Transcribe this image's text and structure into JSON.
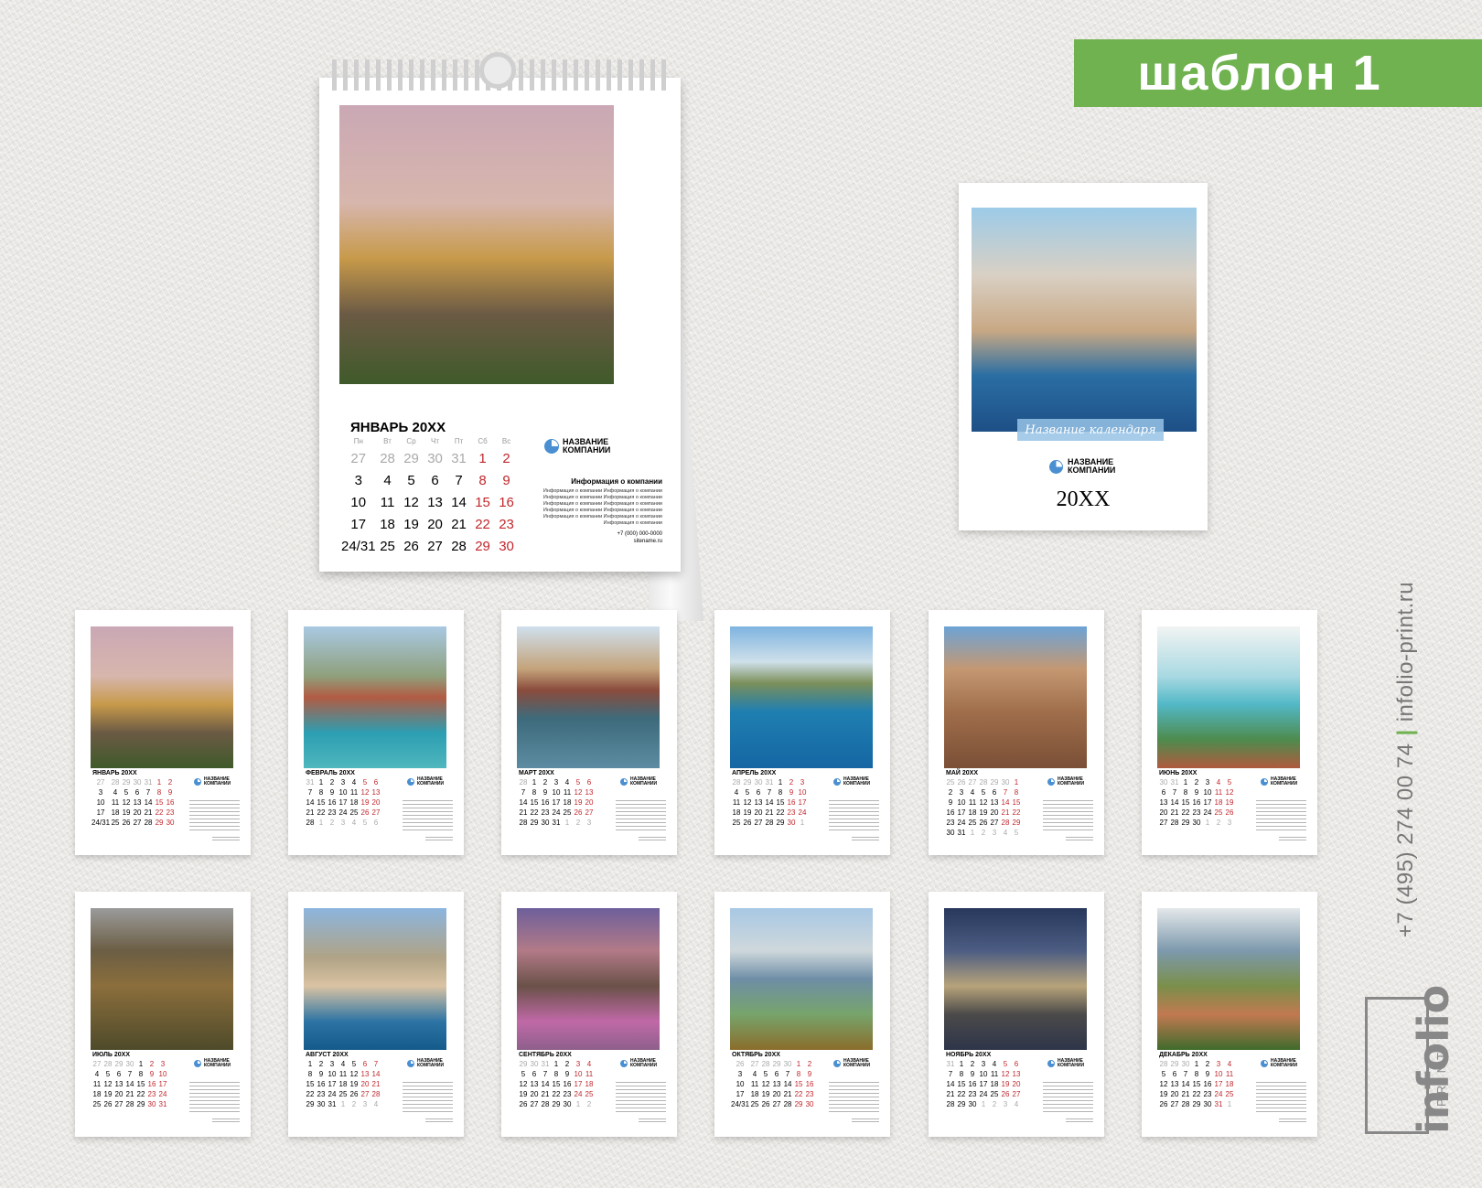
{
  "banner": {
    "label": "шаблон 1"
  },
  "desk": {
    "month_title": "ЯНВАРЬ 20ХХ",
    "weekdays": [
      "Пн",
      "Вт",
      "Ср",
      "Чт",
      "Пт",
      "Сб",
      "Вс"
    ],
    "weeks": [
      [
        "27",
        "28",
        "29",
        "30",
        "31",
        "1",
        "2"
      ],
      [
        "3",
        "4",
        "5",
        "6",
        "7",
        "8",
        "9"
      ],
      [
        "10",
        "11",
        "12",
        "13",
        "14",
        "15",
        "16"
      ],
      [
        "17",
        "18",
        "19",
        "20",
        "21",
        "22",
        "23"
      ],
      [
        "24/31",
        "25",
        "26",
        "27",
        "28",
        "29",
        "30"
      ]
    ],
    "company": "НАЗВАНИЕ\nКОМПАНИИ",
    "info_title": "Информация о компании",
    "info_text": "Информация о компании Информация о компании Информация о компании Информация о компании Информация о компании Информация о компании Информация о компании Информация о компании Информация о компании Информация о компании Информация о компании",
    "phone": "+7 (000) 000-0000",
    "site": "sitename.ru"
  },
  "cover": {
    "title": "Название календаря",
    "company": "НАЗВАНИЕ\nКОМПАНИИ",
    "year": "20ХХ"
  },
  "months": [
    {
      "title": "ЯНВАРЬ 20ХХ",
      "photo": "ph-dome"
    },
    {
      "title": "ФЕВРАЛЬ 20ХХ",
      "photo": "ph-dub"
    },
    {
      "title": "МАРТ 20ХХ",
      "photo": "ph-town"
    },
    {
      "title": "АПРЕЛЬ 20ХХ",
      "photo": "ph-sea"
    },
    {
      "title": "МАЙ 20ХХ",
      "photo": "ph-cath"
    },
    {
      "title": "ИЮНЬ 20ХХ",
      "photo": "ph-bay"
    },
    {
      "title": "ИЮЛЬ 20ХХ",
      "photo": "ph-monast"
    },
    {
      "title": "АВГУСТ 20ХХ",
      "photo": "ph-mon"
    },
    {
      "title": "СЕНТЯБРЬ 20ХХ",
      "photo": "ph-canal"
    },
    {
      "title": "ОКТЯБРЬ 20ХХ",
      "photo": "ph-river"
    },
    {
      "title": "НОЯБРЬ 20ХХ",
      "photo": "ph-night"
    },
    {
      "title": "ДЕКАБРЬ 20ХХ",
      "photo": "ph-coast"
    }
  ],
  "mini_weeks": [
    [
      [
        "27",
        "28",
        "29",
        "30",
        "31",
        "1",
        "2"
      ],
      [
        "3",
        "4",
        "5",
        "6",
        "7",
        "8",
        "9"
      ],
      [
        "10",
        "11",
        "12",
        "13",
        "14",
        "15",
        "16"
      ],
      [
        "17",
        "18",
        "19",
        "20",
        "21",
        "22",
        "23"
      ],
      [
        "24/31",
        "25",
        "26",
        "27",
        "28",
        "29",
        "30"
      ]
    ],
    [
      [
        "31",
        "1",
        "2",
        "3",
        "4",
        "5",
        "6"
      ],
      [
        "7",
        "8",
        "9",
        "10",
        "11",
        "12",
        "13"
      ],
      [
        "14",
        "15",
        "16",
        "17",
        "18",
        "19",
        "20"
      ],
      [
        "21",
        "22",
        "23",
        "24",
        "25",
        "26",
        "27"
      ],
      [
        "28",
        "1",
        "2",
        "3",
        "4",
        "5",
        "6"
      ]
    ],
    [
      [
        "28",
        "1",
        "2",
        "3",
        "4",
        "5",
        "6"
      ],
      [
        "7",
        "8",
        "9",
        "10",
        "11",
        "12",
        "13"
      ],
      [
        "14",
        "15",
        "16",
        "17",
        "18",
        "19",
        "20"
      ],
      [
        "21",
        "22",
        "23",
        "24",
        "25",
        "26",
        "27"
      ],
      [
        "28",
        "29",
        "30",
        "31",
        "1",
        "2",
        "3"
      ]
    ],
    [
      [
        "28",
        "29",
        "30",
        "31",
        "1",
        "2",
        "3"
      ],
      [
        "4",
        "5",
        "6",
        "7",
        "8",
        "9",
        "10"
      ],
      [
        "11",
        "12",
        "13",
        "14",
        "15",
        "16",
        "17"
      ],
      [
        "18",
        "19",
        "20",
        "21",
        "22",
        "23",
        "24"
      ],
      [
        "25",
        "26",
        "27",
        "28",
        "29",
        "30",
        "1"
      ]
    ],
    [
      [
        "25",
        "26",
        "27",
        "28",
        "29",
        "30",
        "1"
      ],
      [
        "2",
        "3",
        "4",
        "5",
        "6",
        "7",
        "8"
      ],
      [
        "9",
        "10",
        "11",
        "12",
        "13",
        "14",
        "15"
      ],
      [
        "16",
        "17",
        "18",
        "19",
        "20",
        "21",
        "22"
      ],
      [
        "23",
        "24",
        "25",
        "26",
        "27",
        "28",
        "29"
      ],
      [
        "30",
        "31",
        "1",
        "2",
        "3",
        "4",
        "5"
      ]
    ],
    [
      [
        "30",
        "31",
        "1",
        "2",
        "3",
        "4",
        "5"
      ],
      [
        "6",
        "7",
        "8",
        "9",
        "10",
        "11",
        "12"
      ],
      [
        "13",
        "14",
        "15",
        "16",
        "17",
        "18",
        "19"
      ],
      [
        "20",
        "21",
        "22",
        "23",
        "24",
        "25",
        "26"
      ],
      [
        "27",
        "28",
        "29",
        "30",
        "1",
        "2",
        "3"
      ]
    ],
    [
      [
        "27",
        "28",
        "29",
        "30",
        "1",
        "2",
        "3"
      ],
      [
        "4",
        "5",
        "6",
        "7",
        "8",
        "9",
        "10"
      ],
      [
        "11",
        "12",
        "13",
        "14",
        "15",
        "16",
        "17"
      ],
      [
        "18",
        "19",
        "20",
        "21",
        "22",
        "23",
        "24"
      ],
      [
        "25",
        "26",
        "27",
        "28",
        "29",
        "30",
        "31"
      ]
    ],
    [
      [
        "1",
        "2",
        "3",
        "4",
        "5",
        "6",
        "7"
      ],
      [
        "8",
        "9",
        "10",
        "11",
        "12",
        "13",
        "14"
      ],
      [
        "15",
        "16",
        "17",
        "18",
        "19",
        "20",
        "21"
      ],
      [
        "22",
        "23",
        "24",
        "25",
        "26",
        "27",
        "28"
      ],
      [
        "29",
        "30",
        "31",
        "1",
        "2",
        "3",
        "4"
      ]
    ],
    [
      [
        "29",
        "30",
        "31",
        "1",
        "2",
        "3",
        "4"
      ],
      [
        "5",
        "6",
        "7",
        "8",
        "9",
        "10",
        "11"
      ],
      [
        "12",
        "13",
        "14",
        "15",
        "16",
        "17",
        "18"
      ],
      [
        "19",
        "20",
        "21",
        "22",
        "23",
        "24",
        "25"
      ],
      [
        "26",
        "27",
        "28",
        "29",
        "30",
        "1",
        "2"
      ]
    ],
    [
      [
        "26",
        "27",
        "28",
        "29",
        "30",
        "1",
        "2"
      ],
      [
        "3",
        "4",
        "5",
        "6",
        "7",
        "8",
        "9"
      ],
      [
        "10",
        "11",
        "12",
        "13",
        "14",
        "15",
        "16"
      ],
      [
        "17",
        "18",
        "19",
        "20",
        "21",
        "22",
        "23"
      ],
      [
        "24/31",
        "25",
        "26",
        "27",
        "28",
        "29",
        "30"
      ]
    ],
    [
      [
        "31",
        "1",
        "2",
        "3",
        "4",
        "5",
        "6"
      ],
      [
        "7",
        "8",
        "9",
        "10",
        "11",
        "12",
        "13"
      ],
      [
        "14",
        "15",
        "16",
        "17",
        "18",
        "19",
        "20"
      ],
      [
        "21",
        "22",
        "23",
        "24",
        "25",
        "26",
        "27"
      ],
      [
        "28",
        "29",
        "30",
        "1",
        "2",
        "3",
        "4"
      ]
    ],
    [
      [
        "28",
        "29",
        "30",
        "1",
        "2",
        "3",
        "4"
      ],
      [
        "5",
        "6",
        "7",
        "8",
        "9",
        "10",
        "11"
      ],
      [
        "12",
        "13",
        "14",
        "15",
        "16",
        "17",
        "18"
      ],
      [
        "19",
        "20",
        "21",
        "22",
        "23",
        "24",
        "25"
      ],
      [
        "26",
        "27",
        "28",
        "29",
        "30",
        "31",
        "1"
      ]
    ]
  ],
  "mini_company": "НАЗВАНИЕ\nКОМПАНИИ",
  "side": {
    "phone": "+7 (495) 274 00 74",
    "separator": "|",
    "site": "infolio-print.ru"
  },
  "brand": {
    "main": "infolio",
    "sub": "PRINT"
  }
}
